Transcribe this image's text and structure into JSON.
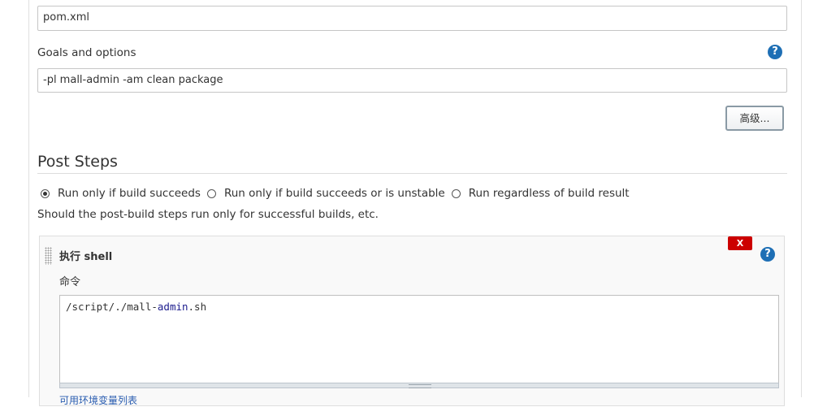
{
  "pom_field": {
    "value": "pom.xml"
  },
  "goals": {
    "label": "Goals and options",
    "help": "?",
    "value": "-pl mall-admin -am clean package"
  },
  "advanced_button": {
    "label": "高级..."
  },
  "post_steps": {
    "title": "Post Steps",
    "radio_options": [
      {
        "label": "Run only if build succeeds",
        "checked": true
      },
      {
        "label": "Run only if build succeeds or is unstable",
        "checked": false
      },
      {
        "label": "Run regardless of build result",
        "checked": false
      }
    ],
    "description": "Should the post-build steps run only for successful builds, etc."
  },
  "shell_step": {
    "title": "执行 shell",
    "delete_label": "X",
    "help": "?",
    "command_label": "命令",
    "command_parts": [
      "/script/./mall-",
      "admin",
      ".sh"
    ],
    "link_clipped": "可用环境变量列表"
  }
}
